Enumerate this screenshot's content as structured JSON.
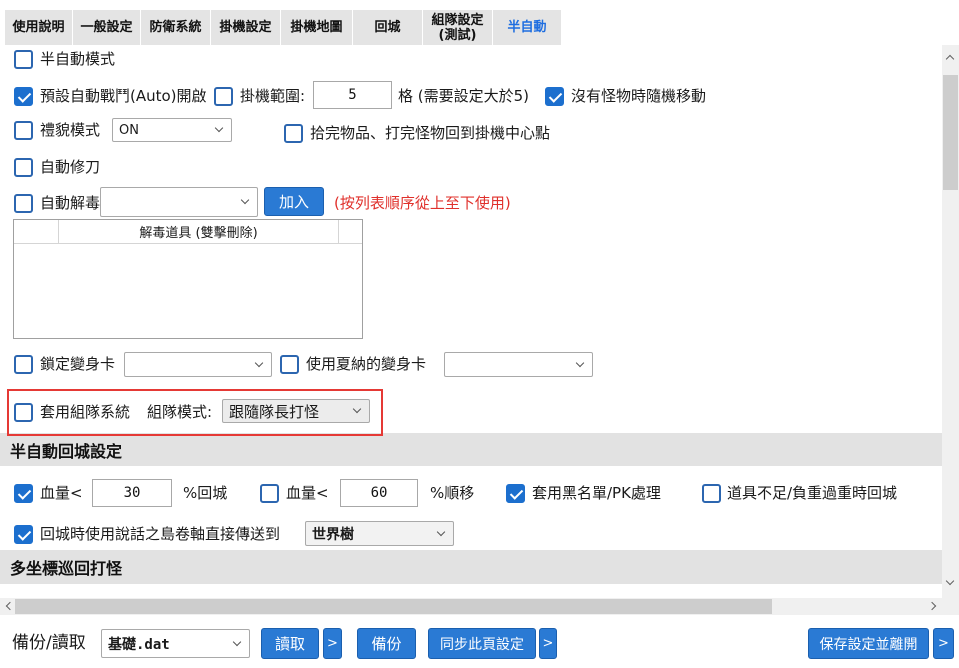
{
  "tabs": [
    {
      "label": "使用說明",
      "active": false
    },
    {
      "label": "一般設定",
      "active": false
    },
    {
      "label": "防衛系統",
      "active": false
    },
    {
      "label": "掛機設定",
      "active": false
    },
    {
      "label": "掛機地圖",
      "active": false
    },
    {
      "label": "回城",
      "active": false
    },
    {
      "label_line1": "組隊設定",
      "label_line2": "(測試)",
      "active": false
    },
    {
      "label": "半自動",
      "active": true
    }
  ],
  "semi_auto": {
    "mode": {
      "label": "半自動模式",
      "checked": false
    },
    "auto_battle": {
      "label": "預設自動戰鬥(Auto)開啟",
      "checked": true
    },
    "range": {
      "label": "掛機範圍:",
      "checked": false,
      "value": "5",
      "unit": "格 (需要設定大於5)"
    },
    "random_move": {
      "label": "沒有怪物時隨機移動",
      "checked": true
    },
    "polite": {
      "label": "禮貌模式",
      "checked": false,
      "selected": "ON"
    },
    "return_center": {
      "label": "拾完物品、打完怪物回到掛機中心點",
      "checked": false
    },
    "auto_repair": {
      "label": "自動修刀",
      "checked": false
    },
    "auto_detox": {
      "label": "自動解毒",
      "checked": false,
      "add_button": "加入",
      "hint": "(按列表順序從上至下使用)"
    },
    "detox_list": {
      "column_header": "解毒道具 (雙擊刪除)"
    },
    "lock_transform": {
      "label": "鎖定變身卡",
      "checked": false
    },
    "shana_transform": {
      "label": "使用夏納的變身卡",
      "checked": false
    },
    "party": {
      "label": "套用組隊系統",
      "checked": false,
      "mode_label": "組隊模式:",
      "selected": "跟隨隊長打怪"
    }
  },
  "return_section": {
    "title": "半自動回城設定",
    "hp_return": {
      "label": "血量<",
      "checked": true,
      "value": "30",
      "suffix": "%回城"
    },
    "hp_teleport": {
      "label": "血量<",
      "checked": false,
      "value": "60",
      "suffix": "%順移"
    },
    "blacklist": {
      "label": "套用黑名單/PK處理",
      "checked": true
    },
    "item_shortage": {
      "label": "道具不足/負重過重時回城",
      "checked": false
    },
    "scroll_teleport": {
      "label": "回城時使用說話之島卷軸直接傳送到",
      "checked": true,
      "selected": "世界樹"
    }
  },
  "patrol_section": {
    "title": "多坐標巡回打怪"
  },
  "footer": {
    "backup_label": "備份/讀取",
    "file_selected": "基礎.dat",
    "load_button": "讀取",
    "load_more": ">",
    "backup_button": "備份",
    "sync_button": "同步此頁設定",
    "sync_more": ">",
    "save_button": "保存設定並離開",
    "save_more": ">"
  },
  "icons": {
    "dropdown": "chevron-down-icon",
    "check": "checkmark-icon",
    "scroll_up": "chevron-up-icon",
    "scroll_down": "chevron-down-icon",
    "scroll_left": "chevron-left-icon",
    "scroll_right": "chevron-right-icon"
  },
  "colors": {
    "accent": "#2a7ad4",
    "check_fill": "#1c6fce",
    "checkbox_border": "#2c66b0",
    "active_tab_text": "#1f6ee0",
    "hint_text": "#e0302b",
    "highlight_border": "#e53935",
    "section_bg": "#e2e2e2",
    "tab_bg": "#e4e4e4"
  }
}
